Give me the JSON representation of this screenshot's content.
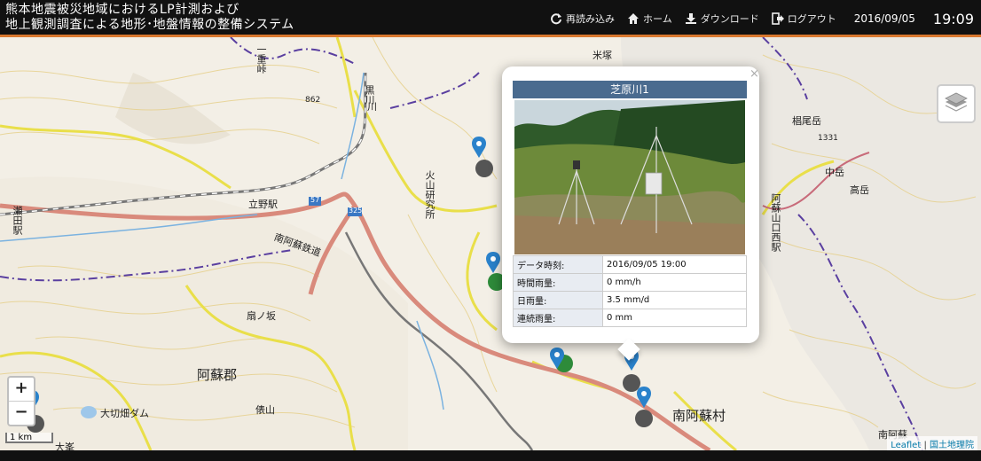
{
  "header": {
    "title_line1": "熊本地震被災地域におけるLP計測および",
    "title_line2": "地上観測調査による地形･地盤情報の整備システム",
    "nav": [
      {
        "label": "再読み込み",
        "icon": "reload-icon"
      },
      {
        "label": "ホーム",
        "icon": "home-icon"
      },
      {
        "label": "ダウンロード",
        "icon": "download-icon"
      },
      {
        "label": "ログアウト",
        "icon": "logout-icon"
      }
    ],
    "date": "2016/09/05",
    "time": "19:09"
  },
  "map": {
    "labels": {
      "tateno_station": "立野駅",
      "minami_aso_railway": "南阿蘇鉄道",
      "aso_gun": "阿蘇郡",
      "ookirihata_dam": "大切畑ダム",
      "minami_aso_village": "南阿蘇村",
      "kazan_kenkyusho": "火山研究所",
      "ichinoseki": "一重峠",
      "elevation_862": "862",
      "yonezuka": "米塚",
      "kuraoyama": "椙尾岳",
      "elevation_1331": "1331",
      "nakadake": "中岳",
      "takadake": "高岳",
      "asonishi_station": "阿蘇山口西駅",
      "setagawa_station": "瀬田駅",
      "kuronokawa": "黒川",
      "tawarayama": "俵山",
      "hakenozaka": "扇ノ坂",
      "route_57": "57",
      "route_325": "325",
      "minami_aso_kogen": "南阿蘇",
      "ootou": "大峯",
      "kumogawa": "川"
    },
    "zoom_in": "+",
    "zoom_out": "−",
    "scale": "1 km",
    "attribution_leaflet": "Leaflet",
    "attribution_sep": "|",
    "attribution_gsi": "国土地理院"
  },
  "popup": {
    "close": "×",
    "title": "芝原川1",
    "rows": [
      {
        "key": "データ時刻:",
        "value": "2016/09/05 19:00"
      },
      {
        "key": "時間雨量:",
        "value": "0 mm/h"
      },
      {
        "key": "日雨量:",
        "value": "3.5 mm/d"
      },
      {
        "key": "連続雨量:",
        "value": "0 mm"
      }
    ]
  },
  "colors": {
    "header_bg": "#111111",
    "header_accent": "#d9782f",
    "popup_title_bg": "#4a6b8f",
    "marker_blue": "#2a82cb",
    "marker_green": "#2e8b3a",
    "road_red": "#d98a7c",
    "road_yellow": "#e9df4a",
    "boundary_purple": "#5a3fa0",
    "contour": "#e6cf88"
  }
}
